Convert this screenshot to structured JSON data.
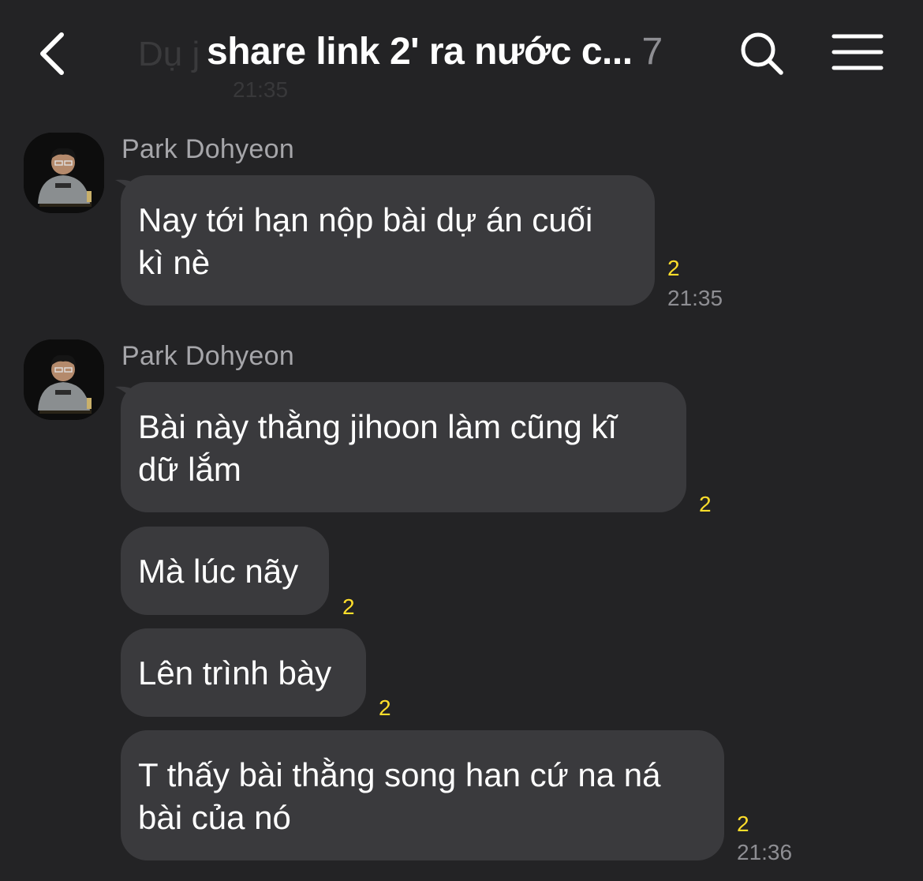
{
  "header": {
    "title": "share link 2' ra nước c...",
    "member_count": "7",
    "ghost_name": "Dụ j",
    "ghost_time": "21:35"
  },
  "icons": {
    "back": "chevron-left-icon",
    "search": "search-icon",
    "menu": "hamburger-menu-icon"
  },
  "groups": [
    {
      "sender": "Park Dohyeon",
      "messages": [
        {
          "lines": [
            "Nay tới hạn nộp bài dự án cuối",
            "kì nè"
          ],
          "unread": "2",
          "time": "21:35"
        }
      ]
    },
    {
      "sender": "Park Dohyeon",
      "messages": [
        {
          "lines": [
            "Bài này thằng jihoon làm cũng kĩ",
            "dữ lắm"
          ],
          "unread": "2",
          "time": ""
        },
        {
          "lines": [
            "Mà lúc nãy"
          ],
          "unread": "2",
          "time": ""
        },
        {
          "lines": [
            "Lên trình bày"
          ],
          "unread": "2",
          "time": ""
        },
        {
          "lines": [
            "T thấy bài thằng song han cứ na ná",
            "bài của nó"
          ],
          "unread": "2",
          "time": "21:36"
        }
      ]
    }
  ],
  "colors": {
    "background": "#232325",
    "bubble": "#3a3a3d",
    "unread": "#ffde2b",
    "muted": "#8e8e93"
  }
}
